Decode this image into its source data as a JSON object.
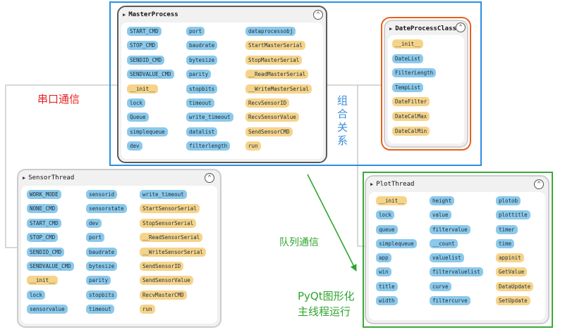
{
  "colors": {
    "attr_pill": "#8cc9ea",
    "method_pill": "#f5d48a",
    "serial_label": "#e52222",
    "composition_label": "#3a8fd8",
    "queue_label": "#2ea52e",
    "pyqt_label": "#2ea52e",
    "master_frame": "#2b8fe0",
    "date_frame": "#e8601e",
    "plot_frame": "#3aa83a"
  },
  "labels": {
    "serial": "串口通信",
    "composition": [
      "组",
      "合",
      "关",
      "系"
    ],
    "queue": "队列通信",
    "pyqt_line1": "PyQt图形化",
    "pyqt_line2": "主线程运行"
  },
  "collapse_icon": "⌃",
  "master": {
    "title": "MasterProcess",
    "rows": [
      [
        {
          "t": "START_CMD",
          "k": "b"
        },
        {
          "t": "port",
          "k": "b"
        },
        {
          "t": "dataprocessobj",
          "k": "b"
        }
      ],
      [
        {
          "t": "STOP_CMD",
          "k": "b"
        },
        {
          "t": "baudrate",
          "k": "b"
        },
        {
          "t": "StartMasterSerial",
          "k": "y"
        }
      ],
      [
        {
          "t": "SENDID_CMD",
          "k": "b"
        },
        {
          "t": "bytesize",
          "k": "b"
        },
        {
          "t": "StopMasterSerial",
          "k": "y"
        }
      ],
      [
        {
          "t": "SENDVALUE_CMD",
          "k": "b"
        },
        {
          "t": "parity",
          "k": "b"
        },
        {
          "t": "__ReadMasterSerial",
          "k": "y"
        }
      ],
      [
        {
          "t": "__init__",
          "k": "y"
        },
        {
          "t": "stopbits",
          "k": "b"
        },
        {
          "t": "__WriteMasterSerial",
          "k": "y"
        }
      ],
      [
        {
          "t": "lock",
          "k": "b"
        },
        {
          "t": "timeout",
          "k": "b"
        },
        {
          "t": "RecvSensorID",
          "k": "y"
        }
      ],
      [
        {
          "t": "Queue",
          "k": "b"
        },
        {
          "t": "write_timeout",
          "k": "b"
        },
        {
          "t": "RecvSensorValue",
          "k": "y"
        }
      ],
      [
        {
          "t": "simplequeue",
          "k": "b"
        },
        {
          "t": "datalist",
          "k": "b"
        },
        {
          "t": "SendSensorCMD",
          "k": "y"
        }
      ],
      [
        {
          "t": "dev",
          "k": "b"
        },
        {
          "t": "filterlength",
          "k": "b"
        },
        {
          "t": "run",
          "k": "y"
        }
      ]
    ]
  },
  "date": {
    "title": "DateProcessClass",
    "items": [
      {
        "t": "__init__",
        "k": "y"
      },
      {
        "t": "DateList",
        "k": "b"
      },
      {
        "t": "FilterLength",
        "k": "b"
      },
      {
        "t": "TempList",
        "k": "b"
      },
      {
        "t": "DateFilter",
        "k": "y"
      },
      {
        "t": "DateCalMax",
        "k": "y"
      },
      {
        "t": "DateCalMin",
        "k": "y"
      }
    ]
  },
  "sensor": {
    "title": "SensorThread",
    "rows": [
      [
        {
          "t": "WORK_MODE",
          "k": "b"
        },
        {
          "t": "sensorid",
          "k": "b"
        },
        {
          "t": "write_timeout",
          "k": "b"
        }
      ],
      [
        {
          "t": "NONE_CMD",
          "k": "b"
        },
        {
          "t": "sensorstate",
          "k": "b"
        },
        {
          "t": "StartSensorSerial",
          "k": "y"
        }
      ],
      [
        {
          "t": "START_CMD",
          "k": "b"
        },
        {
          "t": "dev",
          "k": "b"
        },
        {
          "t": "StopSensorSerial",
          "k": "y"
        }
      ],
      [
        {
          "t": "STOP_CMD",
          "k": "b"
        },
        {
          "t": "port",
          "k": "b"
        },
        {
          "t": "__ReadSensorSerial",
          "k": "y"
        }
      ],
      [
        {
          "t": "SENDID_CMD",
          "k": "b"
        },
        {
          "t": "baudrate",
          "k": "b"
        },
        {
          "t": "__WriteSensorSerial",
          "k": "y"
        }
      ],
      [
        {
          "t": "SENDVALUE_CMD",
          "k": "b"
        },
        {
          "t": "bytesize",
          "k": "b"
        },
        {
          "t": "SendSensorID",
          "k": "y"
        }
      ],
      [
        {
          "t": "__init__",
          "k": "y"
        },
        {
          "t": "parity",
          "k": "b"
        },
        {
          "t": "SendSensorValue",
          "k": "y"
        }
      ],
      [
        {
          "t": "lock",
          "k": "b"
        },
        {
          "t": "stopbits",
          "k": "b"
        },
        {
          "t": "RecvMasterCMD",
          "k": "y"
        }
      ],
      [
        {
          "t": "sensorvalue",
          "k": "b"
        },
        {
          "t": "timeout",
          "k": "b"
        },
        {
          "t": "run",
          "k": "y"
        }
      ]
    ]
  },
  "plot": {
    "title": "PlotThread",
    "rows": [
      [
        {
          "t": "__init__",
          "k": "y"
        },
        {
          "t": "height",
          "k": "b"
        },
        {
          "t": "plotob",
          "k": "b"
        }
      ],
      [
        {
          "t": "lock",
          "k": "b"
        },
        {
          "t": "value",
          "k": "b"
        },
        {
          "t": "plottitle",
          "k": "b"
        }
      ],
      [
        {
          "t": "queue",
          "k": "b"
        },
        {
          "t": "filtervalue",
          "k": "b"
        },
        {
          "t": "timer",
          "k": "b"
        }
      ],
      [
        {
          "t": "simplequeue",
          "k": "b"
        },
        {
          "t": "__count",
          "k": "b"
        },
        {
          "t": "time",
          "k": "b"
        }
      ],
      [
        {
          "t": "app",
          "k": "b"
        },
        {
          "t": "valuelist",
          "k": "b"
        },
        {
          "t": "appinit",
          "k": "y"
        }
      ],
      [
        {
          "t": "win",
          "k": "b"
        },
        {
          "t": "filtervaluelist",
          "k": "b"
        },
        {
          "t": "GetValue",
          "k": "y"
        }
      ],
      [
        {
          "t": "title",
          "k": "b"
        },
        {
          "t": "curve",
          "k": "b"
        },
        {
          "t": "DataUpdate",
          "k": "y"
        }
      ],
      [
        {
          "t": "width",
          "k": "b"
        },
        {
          "t": "filtercurve",
          "k": "b"
        },
        {
          "t": "SetUpdate",
          "k": "y"
        }
      ]
    ]
  }
}
